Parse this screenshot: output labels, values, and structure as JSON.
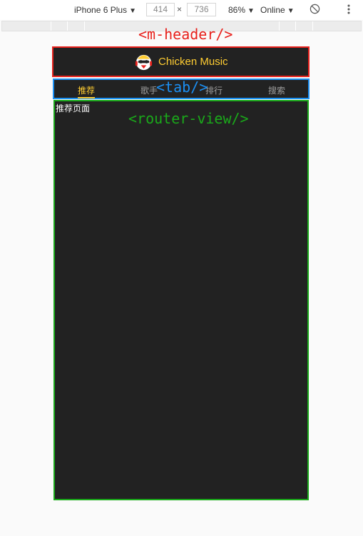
{
  "devtools": {
    "device": "iPhone 6 Plus",
    "width": "414",
    "height": "736",
    "times": "×",
    "zoom": "86%",
    "throttle": "Online",
    "caret": "▼",
    "rotate_icon": "rotate-icon",
    "more_icon": "more-vert-icon"
  },
  "annotations": {
    "header": "<m-header/>",
    "tab": "<tab/>",
    "router_view": "<router-view/>"
  },
  "header": {
    "title": "Chicken Music",
    "logo_icon": "chicken-logo-icon"
  },
  "tabs": [
    {
      "label": "推荐",
      "active": true
    },
    {
      "label": "歌手",
      "active": false
    },
    {
      "label": "排行",
      "active": false
    },
    {
      "label": "搜索",
      "active": false
    }
  ],
  "view": {
    "text": "推荐页面"
  },
  "colors": {
    "brand_yellow": "#ffcd32",
    "dark_bg": "#222222",
    "annotation_red": "#e8211c",
    "annotation_blue": "#1b8ff3",
    "annotation_green": "#1aa91a"
  }
}
